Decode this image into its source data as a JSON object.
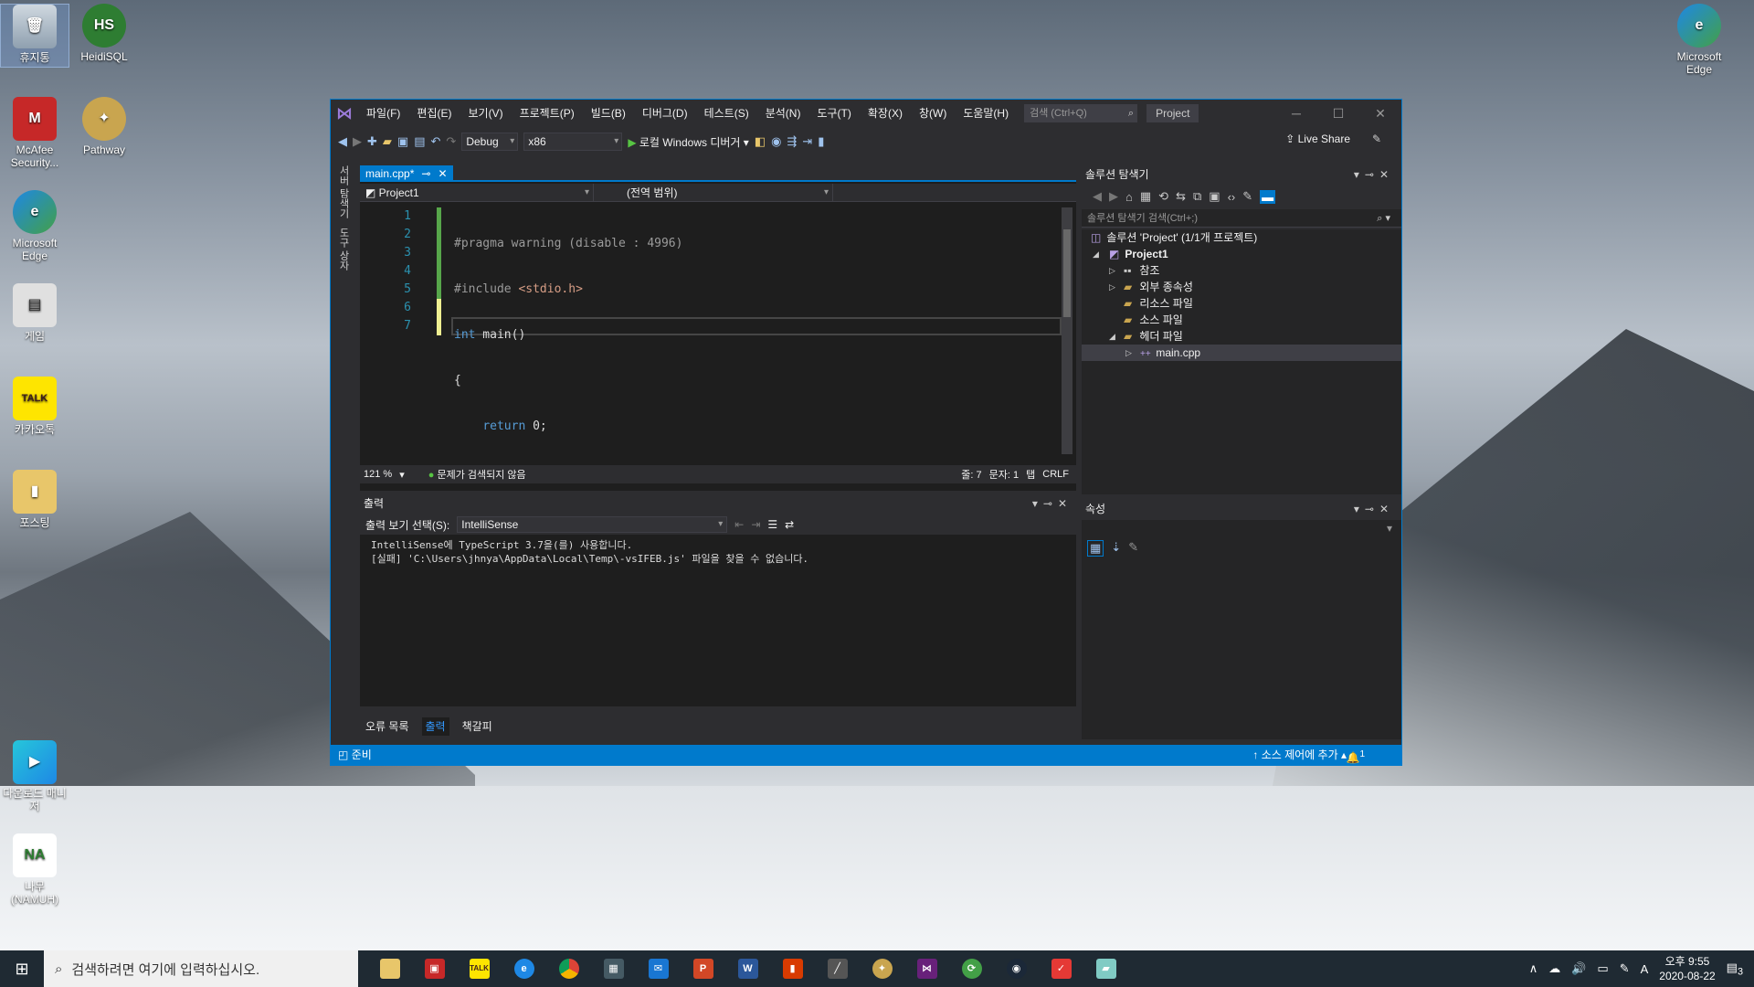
{
  "desktop": {
    "icons_left": [
      {
        "label": "휴지통",
        "icon": "recycle-bin-icon"
      },
      {
        "label": "HeidiSQL",
        "icon": "heidisql-icon"
      },
      {
        "label": "McAfee Security...",
        "icon": "mcafee-icon"
      },
      {
        "label": "Pathway",
        "icon": "pathway-icon"
      },
      {
        "label": "Microsoft Edge",
        "icon": "edge-icon"
      },
      {
        "label": "게임",
        "icon": "game-folder-icon"
      },
      {
        "label": "카카오톡",
        "icon": "kakaotalk-icon"
      },
      {
        "label": "포스팅",
        "icon": "folder-icon"
      },
      {
        "label": "다운로드 매니저",
        "icon": "download-manager-icon"
      },
      {
        "label": "나무 (NAMUH)",
        "icon": "namuh-icon"
      }
    ],
    "icons_right": [
      {
        "label": "Microsoft Edge",
        "icon": "edge-icon"
      }
    ]
  },
  "vs": {
    "menu": [
      "파일(F)",
      "편집(E)",
      "보기(V)",
      "프로젝트(P)",
      "빌드(B)",
      "디버그(D)",
      "테스트(S)",
      "분석(N)",
      "도구(T)",
      "확장(X)",
      "창(W)",
      "도움말(H)"
    ],
    "search_placeholder": "검색 (Ctrl+Q)",
    "project_name": "Project",
    "toolbar": {
      "config": "Debug",
      "platform": "x86",
      "run_label": "로컬 Windows 디버거",
      "live_share": "Live Share"
    },
    "left_strip": [
      "서버 탐색기",
      "도구 상자"
    ],
    "editor": {
      "tab_label": "main.cpp*",
      "nav_project": "Project1",
      "nav_scope": "(전역 범위)",
      "line_numbers": [
        "1",
        "2",
        "3",
        "4",
        "5",
        "6",
        "7"
      ],
      "code": {
        "l1_pp": "#pragma warning (disable : 4996)",
        "l2_kw": "#include ",
        "l2_inc": "<stdio.h>",
        "l3_kw": "int",
        "l3_rest": " main()",
        "l4": "{",
        "l5_kw": "return",
        "l5_rest": " 0;",
        "l6": "}",
        "l7": ""
      },
      "zoom": "121 %",
      "issues": "문제가 검색되지 않음",
      "line": "줄: 7",
      "col": "문자: 1",
      "tab": "탭",
      "eol": "CRLF"
    },
    "output": {
      "title": "출력",
      "source_label": "출력 보기 선택(S):",
      "source_value": "IntelliSense",
      "lines": [
        "IntelliSense에 TypeScript 3.7을(를) 사용합니다.",
        "[실패] 'C:\\Users\\jhnya\\AppData\\Local\\Temp\\-vsIFEB.js' 파일을 찾을 수 없습니다."
      ],
      "tabs": [
        "오류 목록",
        "출력",
        "책갈피"
      ]
    },
    "solution_explorer": {
      "title": "솔루션 탐색기",
      "search_placeholder": "솔루션 탐색기 검색(Ctrl+;)",
      "tree": [
        {
          "label": "솔루션 'Project' (1/1개 프로젝트)"
        },
        {
          "label": "Project1"
        },
        {
          "label": "참조"
        },
        {
          "label": "외부 종속성"
        },
        {
          "label": "리소스 파일"
        },
        {
          "label": "소스 파일"
        },
        {
          "label": "헤더 파일"
        },
        {
          "label": "main.cpp"
        }
      ]
    },
    "properties": {
      "title": "속성"
    },
    "status": {
      "ready": "준비",
      "source_control": "소스 제어에 추가",
      "notification_count": "1"
    }
  },
  "taskbar": {
    "search_placeholder": "검색하려면 여기에 입력하십시오.",
    "apps": [
      "file-explorer-icon",
      "notepad-app-icon",
      "kakaotalk-icon",
      "edge-icon",
      "chrome-icon",
      "store-icon",
      "mail-icon",
      "powerpoint-icon",
      "word-icon",
      "office-icon",
      "stylus-icon",
      "pathway-icon",
      "visual-studio-icon",
      "sync-icon",
      "steam-icon",
      "snip-icon",
      "note-icon"
    ],
    "ime": "A",
    "time": "오후 9:55",
    "date": "2020-08-22",
    "notif_count": "3"
  }
}
